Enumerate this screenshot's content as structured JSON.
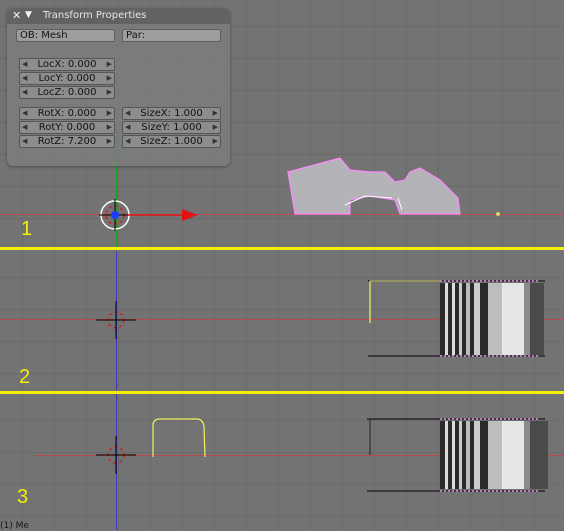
{
  "panel": {
    "title": "Transform Properties",
    "ob_field": "OB: Mesh",
    "par_field": "Par:",
    "loc": [
      "LocX: 0.000",
      "LocY: 0.000",
      "LocZ: 0.000"
    ],
    "rot": [
      "RotX: 0.000",
      "RotY: 0.000",
      "RotZ: 7.200"
    ],
    "size": [
      "SizeX: 1.000",
      "SizeY: 1.000",
      "SizeZ: 1.000"
    ]
  },
  "viewports": [
    {
      "number": "1"
    },
    {
      "number": "2"
    },
    {
      "number": "3"
    }
  ],
  "status": "(1) Me",
  "colors": {
    "background": "#737373",
    "separator": "#f4f000",
    "x_axis": "#b84b4b",
    "selected_wire": "#ff80ff",
    "active_vertex": "#f0f060",
    "arrow": "#e01414"
  },
  "icons": [
    "close-icon",
    "collapse-triangle-icon",
    "left-arrow-icon",
    "right-arrow-icon",
    "3d-cursor-icon",
    "object-center-icon"
  ]
}
